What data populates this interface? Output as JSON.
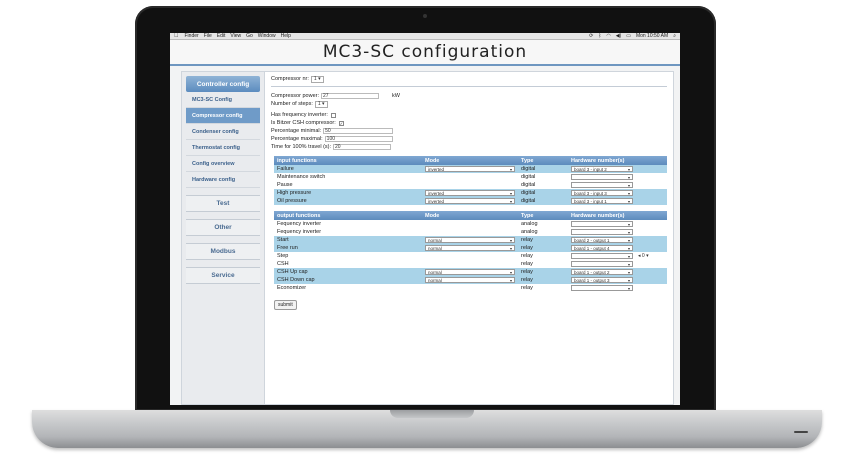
{
  "mac_menubar": {
    "apple": "",
    "items": [
      "Finder",
      "File",
      "Edit",
      "View",
      "Go",
      "Window",
      "Help"
    ],
    "clock": "Mon 10:50 AM"
  },
  "page": {
    "title": "MC3-SC configuration"
  },
  "sidebar": {
    "header": "Controller config",
    "items": [
      {
        "label": "MC3-SC Config",
        "active": false
      },
      {
        "label": "Compressor config",
        "active": true
      },
      {
        "label": "Condenser config",
        "active": false
      },
      {
        "label": "Thermostat config",
        "active": false
      },
      {
        "label": "Config overview",
        "active": false
      },
      {
        "label": "Hardware config",
        "active": false
      }
    ],
    "buttons": [
      "Test",
      "Other",
      "Modbus",
      "Service"
    ]
  },
  "form": {
    "compressor_nr_label": "Compressor nr:",
    "compressor_nr_value": "1",
    "power_label": "Compressor power:",
    "power_value": "27",
    "power_unit": "kW",
    "steps_label": "Number of steps:",
    "steps_value": "1",
    "freq_inverter_label": "Has frequency inverter:",
    "bitzer_label": "Is Bitzer CSH compressor:",
    "pct_min_label": "Percentage minimal:",
    "pct_min_value": "50",
    "pct_max_label": "Percentage maximal:",
    "pct_max_value": "100",
    "travel_label": "Time for 100% travel (s):",
    "travel_value": "20"
  },
  "input_table": {
    "headers": [
      "input functions",
      "Mode",
      "Type",
      "Hardware number(s)"
    ],
    "rows": [
      {
        "name": "Failure",
        "mode": "inverted",
        "type": "digital",
        "hw": "board 3 - input 2",
        "hl": true
      },
      {
        "name": "Maintenance switch",
        "mode": "",
        "type": "digital",
        "hw": "",
        "hl": false
      },
      {
        "name": "Pause",
        "mode": "",
        "type": "digital",
        "hw": "",
        "hl": false
      },
      {
        "name": "High pressure",
        "mode": "inverted",
        "type": "digital",
        "hw": "board 3 - input 3",
        "hl": true
      },
      {
        "name": "Oil pressure",
        "mode": "inverted",
        "type": "digital",
        "hw": "board 3 - input 1",
        "hl": true
      }
    ]
  },
  "output_table": {
    "headers": [
      "output functions",
      "Mode",
      "Type",
      "Hardware number(s)"
    ],
    "rows": [
      {
        "name": "Fequency inverter",
        "mode": "",
        "type": "analog",
        "hw": "",
        "hl": false
      },
      {
        "name": "Fequency inverter",
        "mode": "",
        "type": "analog",
        "hw": "",
        "hl": false
      },
      {
        "name": "Start",
        "mode": "normal",
        "type": "relay",
        "hw": "board 2 - output 1",
        "hl": true
      },
      {
        "name": "Free run",
        "mode": "normal",
        "type": "relay",
        "hw": "board 1 - output 4",
        "hl": true
      },
      {
        "name": "Step",
        "mode": "",
        "type": "relay",
        "hw": "",
        "hl": false,
        "extra": "0"
      },
      {
        "name": "CSH",
        "mode": "",
        "type": "relay",
        "hw": "",
        "hl": false
      },
      {
        "name": "CSH Up cap",
        "mode": "normal",
        "type": "relay",
        "hw": "board 1 - output 2",
        "hl": true
      },
      {
        "name": "CSH Down cap",
        "mode": "normal",
        "type": "relay",
        "hw": "board 1 - output 3",
        "hl": true
      },
      {
        "name": "Economizer",
        "mode": "",
        "type": "relay",
        "hw": "",
        "hl": false
      }
    ]
  },
  "submit_label": "submit"
}
